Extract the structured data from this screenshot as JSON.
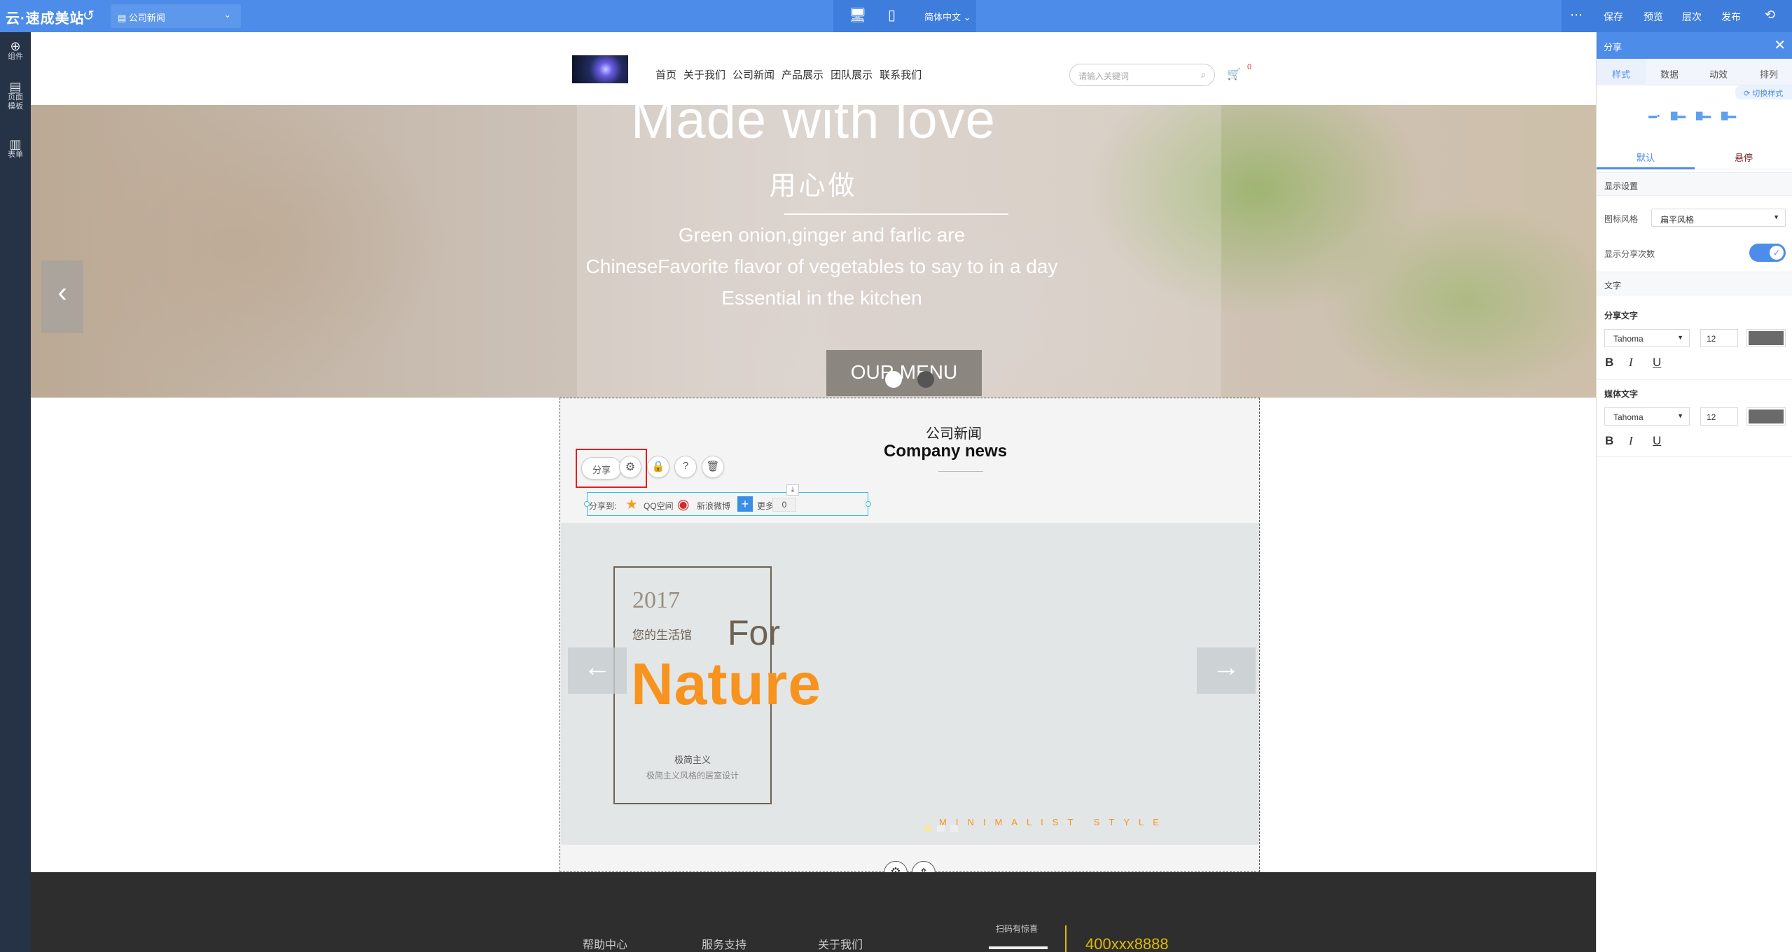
{
  "topbar": {
    "logo": "云·速成美站",
    "page_select": "公司新闻",
    "language": "简体中文",
    "actions": [
      "保存",
      "预览",
      "层次",
      "发布"
    ]
  },
  "leftbar": {
    "items": [
      {
        "icon": "plus-circle-icon",
        "label": "组件"
      },
      {
        "icon": "page-icon",
        "label": "页面\n模板"
      },
      {
        "icon": "clipboard-icon",
        "label": "表单"
      }
    ]
  },
  "site": {
    "nav": [
      "首页",
      "关于我们",
      "公司新闻",
      "产品展示",
      "团队展示",
      "联系我们"
    ],
    "search_placeholder": "请输入关键词",
    "cart_count": "0",
    "banner": {
      "headline": "Made with love",
      "cn_title": "用心做",
      "desc_lines": [
        "Green onion,ginger and farlic are",
        "ChineseFavorite flavor of vegetables to say to in a day",
        "Essential in the kitchen"
      ],
      "button": "OUR MENU"
    },
    "news": {
      "title_cn": "公司新闻",
      "title_en": "Company news",
      "share_button": "分享",
      "share_bar": {
        "prefix": "分享到:",
        "qq": "QQ空间",
        "weibo": "新浪微博",
        "more": "更多",
        "count": "0"
      },
      "slide": {
        "year": "2017",
        "subtitle": "您的生活馆",
        "for": "For",
        "nature": "Nature",
        "caption_title": "极简主义",
        "caption_sub": "极简主义风格的居室设计",
        "tagline": "MINIMALIST STYLE"
      }
    },
    "footer": {
      "links": [
        "帮助中心",
        "服务支持",
        "关于我们"
      ],
      "scan_text": "扫码有惊喜",
      "phone": "400xxx8888"
    }
  },
  "panel": {
    "title": "分享",
    "tabs": [
      "样式",
      "数据",
      "动效",
      "排列"
    ],
    "switch_style": "切换样式",
    "subtabs": [
      "默认",
      "悬停"
    ],
    "display_section": "显示设置",
    "icon_style_label": "图标风格",
    "icon_style_value": "扁平风格",
    "show_count_label": "显示分享次数",
    "show_count_enabled": true,
    "text_section": "文字",
    "share_text_label": "分享文字",
    "share_font": "Tahoma",
    "share_size": "12",
    "media_text_label": "媒体文字",
    "media_font": "Tahoma",
    "media_size": "12",
    "text_color": "#6a6a6a",
    "format_buttons": [
      "B",
      "I",
      "U"
    ]
  },
  "colors": {
    "accent": "#4d8ce8",
    "dark_sidebar": "#263245",
    "nature_orange": "#f7931e",
    "selection_red": "#e02020"
  }
}
